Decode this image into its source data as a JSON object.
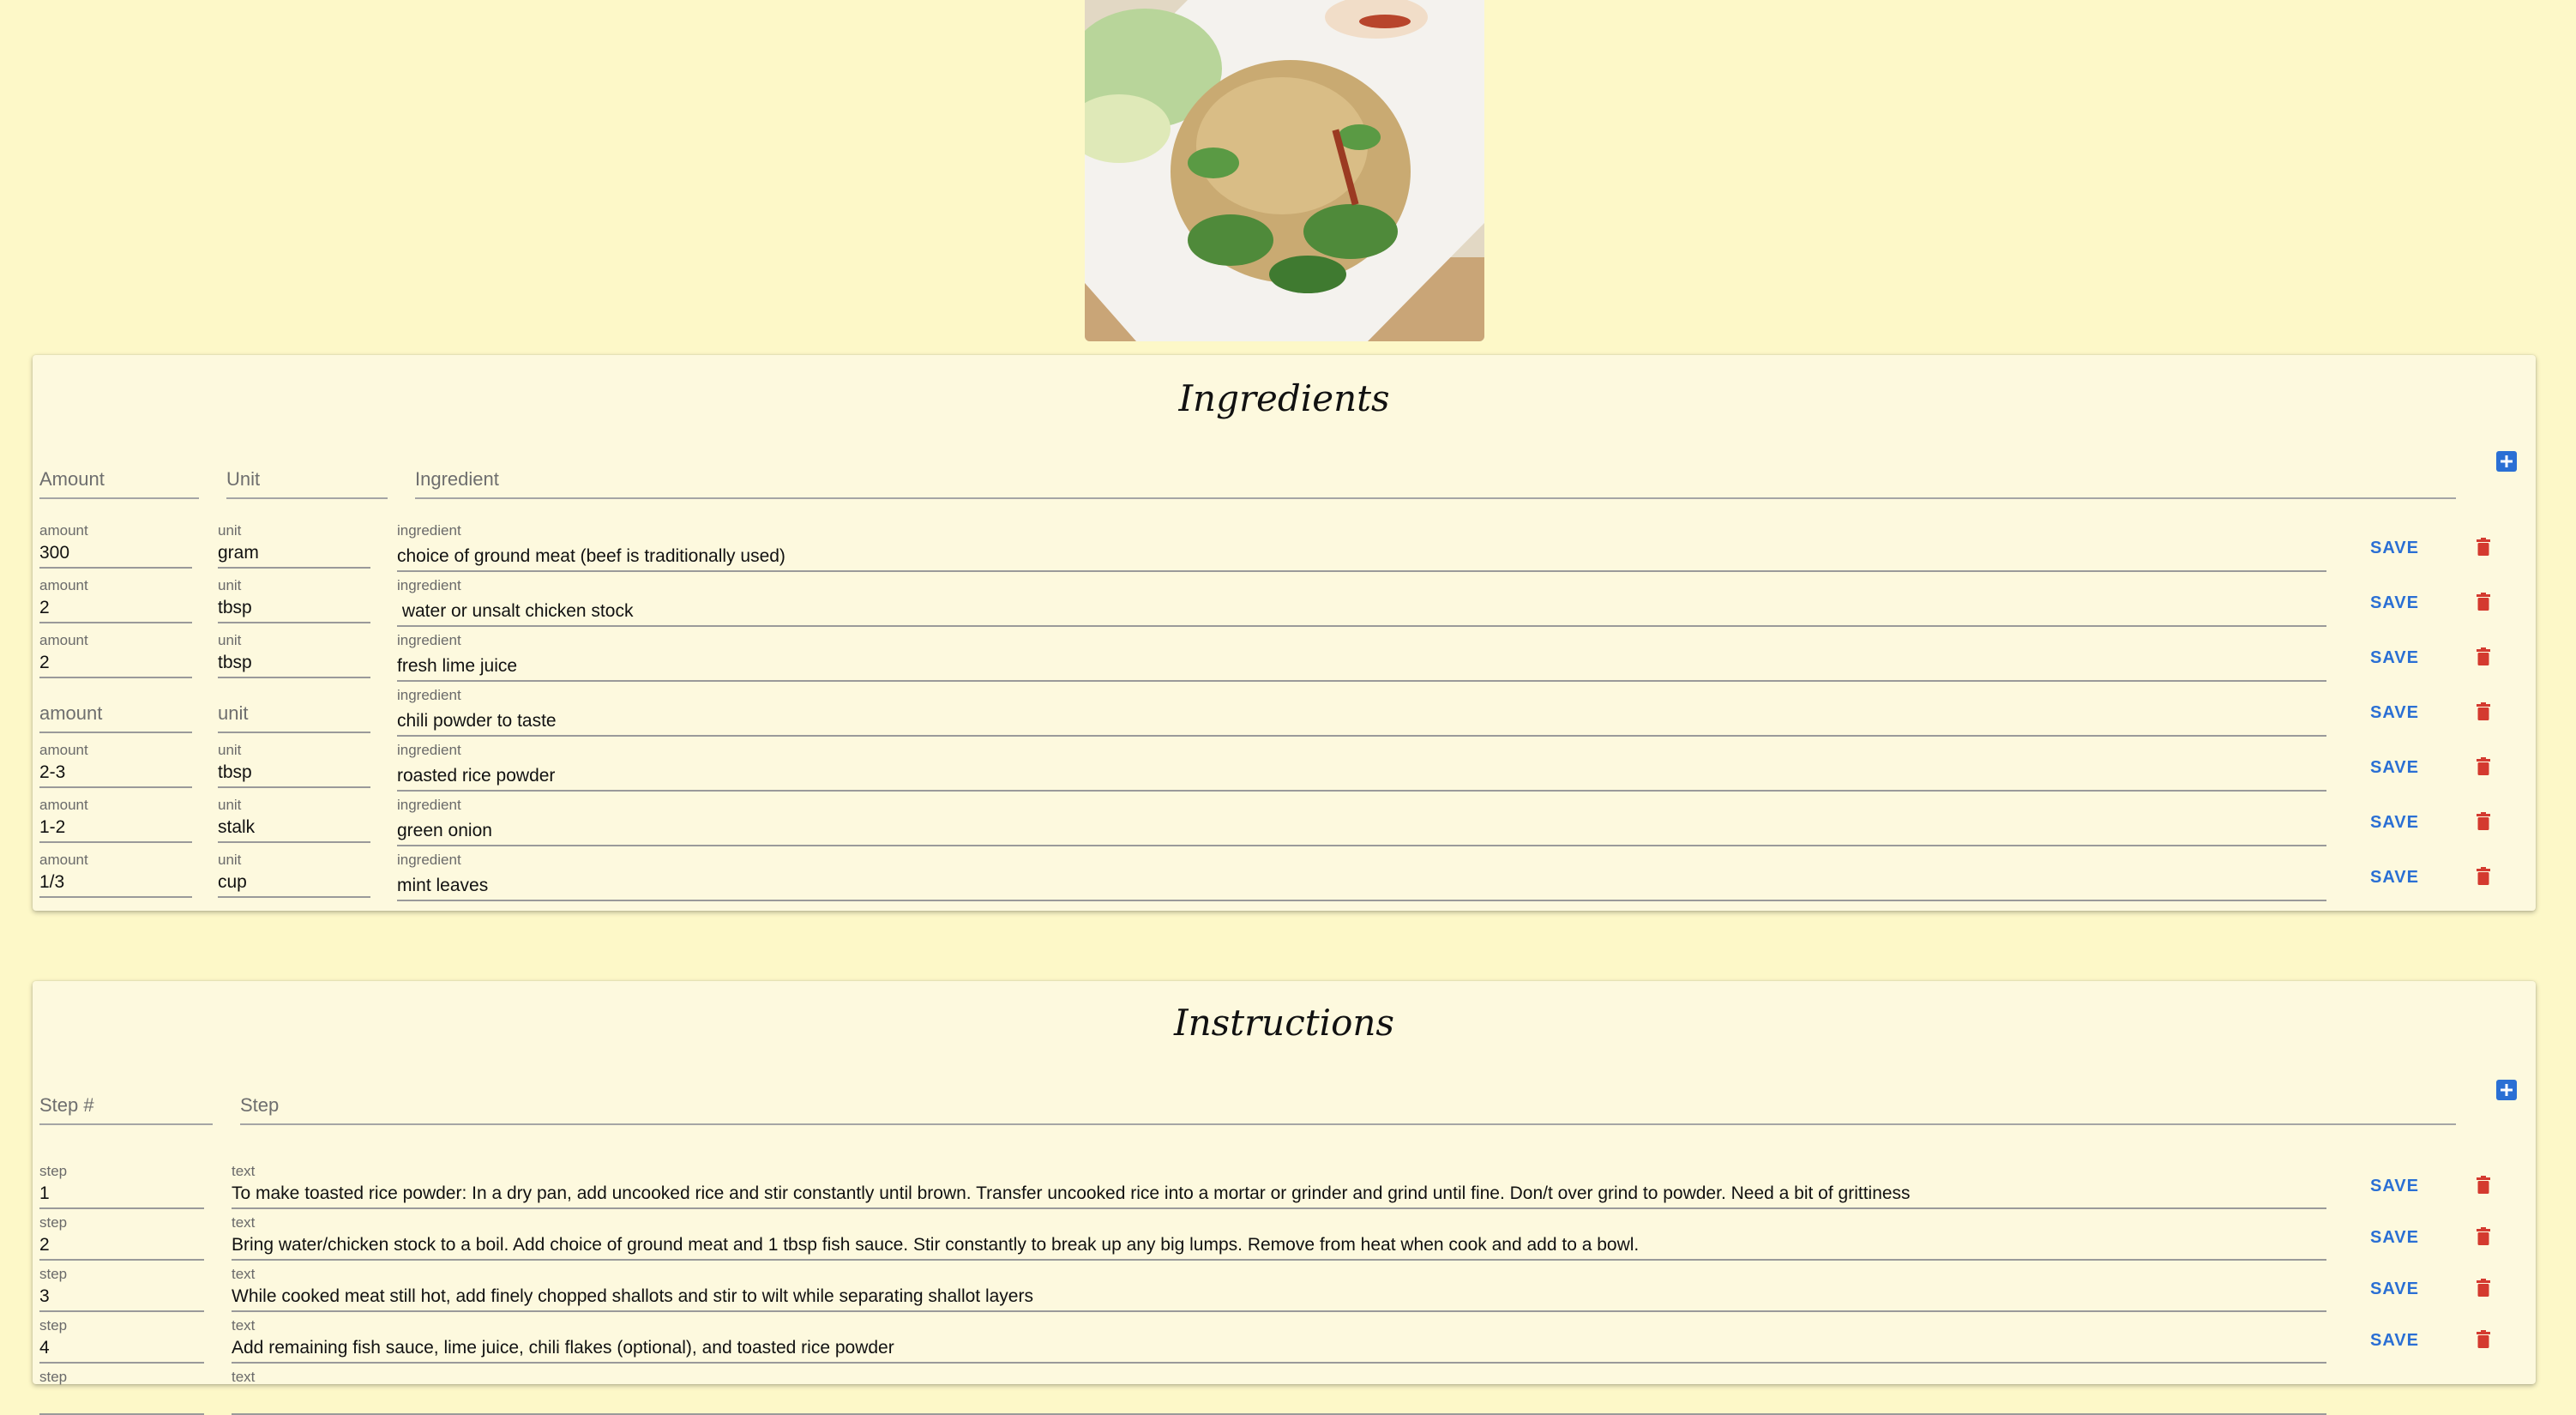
{
  "photo": {
    "alt_icon": "larb-dish-photo"
  },
  "ingredients": {
    "title": "Ingredients",
    "header": {
      "amount": "Amount",
      "unit": "Unit",
      "ingredient": "Ingredient"
    },
    "field_labels": {
      "amount": "amount",
      "unit": "unit",
      "ingredient": "ingredient"
    },
    "rows": [
      {
        "amount": "300",
        "unit": "gram",
        "ingredient": "choice of ground meat (beef is traditionally used)"
      },
      {
        "amount": "2",
        "unit": "tbsp",
        "ingredient": " water or unsalt chicken stock"
      },
      {
        "amount": "2",
        "unit": "tbsp",
        "ingredient": "fresh lime juice"
      },
      {
        "amount": "",
        "unit": "",
        "ingredient": "chili powder to taste",
        "amount_placeholder": "amount",
        "unit_placeholder": "unit"
      },
      {
        "amount": "2-3",
        "unit": "tbsp",
        "ingredient": "roasted rice powder"
      },
      {
        "amount": "1-2",
        "unit": "stalk",
        "ingredient": "green onion"
      },
      {
        "amount": "1/3",
        "unit": "cup",
        "ingredient": "mint leaves"
      }
    ],
    "save_label": "SAVE"
  },
  "instructions": {
    "title": "Instructions",
    "header": {
      "step": "Step #",
      "text": "Step"
    },
    "field_labels": {
      "step": "step",
      "text": "text"
    },
    "rows": [
      {
        "step": "1",
        "text": "To make toasted rice powder: In a dry pan, add uncooked rice and stir constantly until brown. Transfer uncooked rice into a mortar or grinder and grind until fine. Don/t over grind to powder. Need a bit of grittiness"
      },
      {
        "step": "2",
        "text": "Bring water/chicken stock to a boil. Add choice of ground meat and 1 tbsp fish sauce. Stir constantly to break up any big lumps. Remove from heat when cook and add to a bowl."
      },
      {
        "step": "3",
        "text": "While cooked meat still hot, add finely chopped shallots and stir to wilt while separating shallot layers"
      },
      {
        "step": "4",
        "text": "Add remaining fish sauce, lime juice, chili flakes (optional), and toasted rice powder"
      }
    ],
    "save_label": "SAVE"
  },
  "colors": {
    "background": "#fdf8c8",
    "card": "#fdf9de",
    "accent": "#2a6fd4",
    "delete": "#d43a2f"
  }
}
